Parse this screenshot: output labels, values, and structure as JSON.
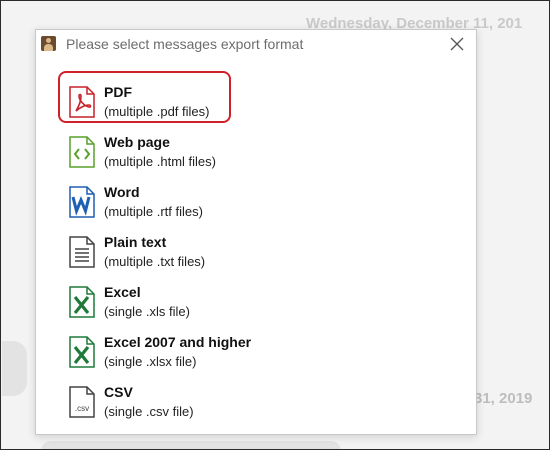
{
  "background": {
    "date_top": "Wednesday, December 11, 201",
    "date_bottom": "31, 2019"
  },
  "dialog": {
    "title": "Please select messages export format",
    "close_icon": "close-icon"
  },
  "options": [
    {
      "name": "PDF",
      "desc": "(multiple .pdf files)",
      "icon": "pdf-icon",
      "color": "#c8202a",
      "selected": true
    },
    {
      "name": "Web page",
      "desc": "(multiple .html files)",
      "icon": "html-icon",
      "color": "#5aa02c"
    },
    {
      "name": "Word",
      "desc": "(multiple .rtf files)",
      "icon": "word-icon",
      "color": "#1e5fb4"
    },
    {
      "name": "Plain text",
      "desc": "(multiple .txt files)",
      "icon": "text-file-icon",
      "color": "#444444"
    },
    {
      "name": "Excel",
      "desc": "(single .xls file)",
      "icon": "excel-icon",
      "color": "#1f7a3a"
    },
    {
      "name": "Excel 2007 and higher",
      "desc": "(single .xlsx file)",
      "icon": "excel-icon",
      "color": "#1f7a3a"
    },
    {
      "name": "CSV",
      "desc": "(single .csv file)",
      "icon": "csv-icon",
      "icon_label": ".csv",
      "color": "#444444"
    }
  ]
}
